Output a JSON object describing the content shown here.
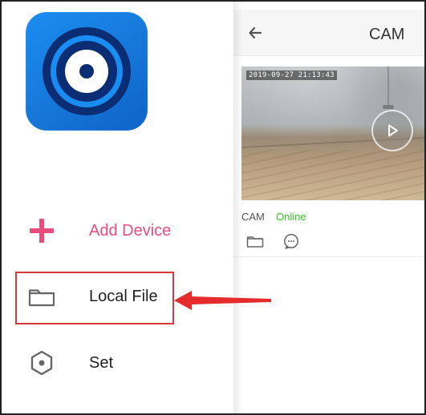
{
  "app": {
    "logo_icon": "eye-camera-logo",
    "colors": {
      "accent_pink": "#ea4c7c",
      "online_green": "#34c924",
      "highlight_red": "#d9383f",
      "logo_blue": "#1a8df2"
    }
  },
  "drawer": {
    "items": [
      {
        "label": "Add Device",
        "icon": "plus-icon"
      },
      {
        "label": "Local File",
        "icon": "folder-icon"
      },
      {
        "label": "Set",
        "icon": "settings-icon"
      }
    ]
  },
  "panel": {
    "title": "CAM",
    "back_icon": "back-arrow-icon"
  },
  "device": {
    "timestamp": "2019-09-27 21:13:43",
    "name": "CAM",
    "status": "Online",
    "play_icon": "play-icon",
    "actions": [
      {
        "icon": "folder-icon"
      },
      {
        "icon": "chat-icon"
      }
    ]
  }
}
